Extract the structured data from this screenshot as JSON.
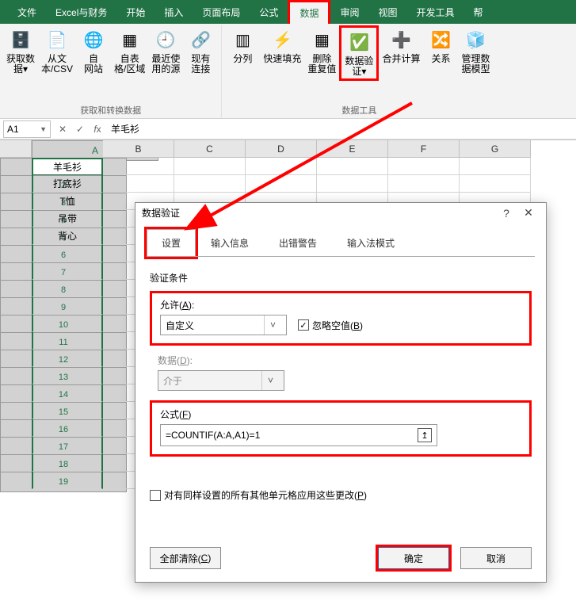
{
  "ribbon": {
    "tabs": [
      "文件",
      "Excel与财务",
      "开始",
      "插入",
      "页面布局",
      "公式",
      "数据",
      "审阅",
      "视图",
      "开发工具",
      "帮"
    ],
    "active": "数据",
    "groups": {
      "get_transform_label": "获取和转换数据",
      "data_tools_label": "数据工具",
      "btns": {
        "get_data": "获取数\n据▾",
        "from_csv": "从文\n本/CSV",
        "from_web": "自\n网站",
        "from_table": "自表\n格/区域",
        "recent": "最近使\n用的源",
        "existing_conn": "现有\n连接",
        "text_to_col": "分列",
        "flash_fill": "快速填充",
        "remove_dup": "删除\n重复值",
        "data_val": "数据验\n证▾",
        "consolidate": "合并计算",
        "relations": "关系",
        "manage_model": "管理数\n据模型"
      }
    }
  },
  "fxbar": {
    "name": "A1",
    "fx_value": "羊毛衫"
  },
  "sheet": {
    "cols": [
      "A",
      "B",
      "C",
      "D",
      "E",
      "F",
      "G"
    ],
    "rows": 19,
    "data": {
      "1": "羊毛衫",
      "2": "打底衫",
      "3": "T恤",
      "4": "吊带",
      "5": "背心"
    }
  },
  "dialog": {
    "title": "数据验证",
    "tabs": [
      "设置",
      "输入信息",
      "出错警告",
      "输入法模式"
    ],
    "active_tab": "设置",
    "cond_label": "验证条件",
    "allow_label": "允许(A):",
    "allow_value": "自定义",
    "ignore_blank": "忽略空值(B)",
    "data_label": "数据(D):",
    "data_value": "介于",
    "formula_label": "公式(F)",
    "formula_value": "=COUNTIF(A:A,A1)=1",
    "apply_all": "对有同样设置的所有其他单元格应用这些更改(P)",
    "clear_all": "全部清除(C)",
    "ok": "确定",
    "cancel": "取消"
  }
}
